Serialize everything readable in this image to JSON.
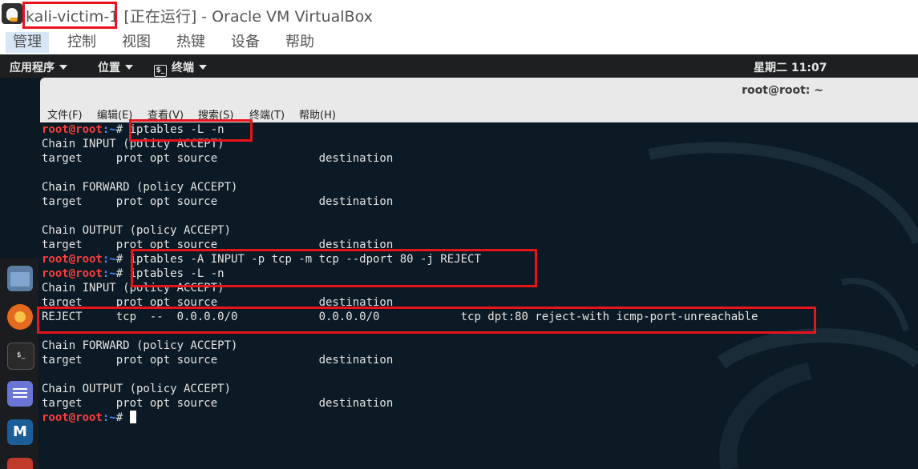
{
  "window": {
    "vm_name": "kali-victim-1",
    "title_rest": " [正在运行] - Oracle VM VirtualBox"
  },
  "vbox_menu": [
    {
      "label": "管理"
    },
    {
      "label": "控制"
    },
    {
      "label": "视图"
    },
    {
      "label": "热键"
    },
    {
      "label": "设备"
    },
    {
      "label": "帮助"
    }
  ],
  "gnome_panel": {
    "applications": "应用程序",
    "places": "位置",
    "terminal": "终端",
    "terminal_glyph": "$_",
    "clock": "星期二 11:07"
  },
  "dock": {
    "items": [
      "file-manager",
      "firefox",
      "terminal",
      "text-editor",
      "metasploit",
      "app"
    ],
    "terminal_glyph": "$_",
    "metasploit_glyph": "M"
  },
  "terminal_window": {
    "title": "root@root: ~",
    "menu": [
      {
        "label": "文件(F)"
      },
      {
        "label": "编辑(E)"
      },
      {
        "label": "查看(V)"
      },
      {
        "label": "搜索(S)"
      },
      {
        "label": "终端(T)"
      },
      {
        "label": "帮助(H)"
      }
    ]
  },
  "terminal": {
    "prompt_user": "root@root",
    "prompt_path": ":~",
    "prompt_symbol": "# ",
    "cmd1": "iptables -L -n",
    "cmd2": "iptables -A INPUT -p tcp -m tcp --dport 80 -j REJECT",
    "cmd3": "iptables -L -n",
    "out1_input": "Chain INPUT (policy ACCEPT)",
    "out1_input_hdr": "target     prot opt source               destination",
    "out1_forward": "Chain FORWARD (policy ACCEPT)",
    "out1_forward_hdr": "target     prot opt source               destination",
    "out1_output": "Chain OUTPUT (policy ACCEPT)",
    "out1_output_hdr": "target     prot opt source               destination",
    "out2_input": "Chain INPUT (policy ACCEPT)",
    "out2_input_hdr": "target     prot opt source               destination",
    "out2_reject": "REJECT     tcp  --  0.0.0.0/0            0.0.0.0/0            tcp dpt:80 reject-with icmp-port-unreachable",
    "out2_forward": "Chain FORWARD (policy ACCEPT)",
    "out2_forward_hdr": "target     prot opt source               destination",
    "out2_output": "Chain OUTPUT (policy ACCEPT)",
    "out2_output_hdr": "target     prot opt source               destination"
  },
  "colors": {
    "highlight": "#e8141c",
    "prompt_user": "#ff3d3d",
    "prompt_path": "#4d8cff"
  }
}
